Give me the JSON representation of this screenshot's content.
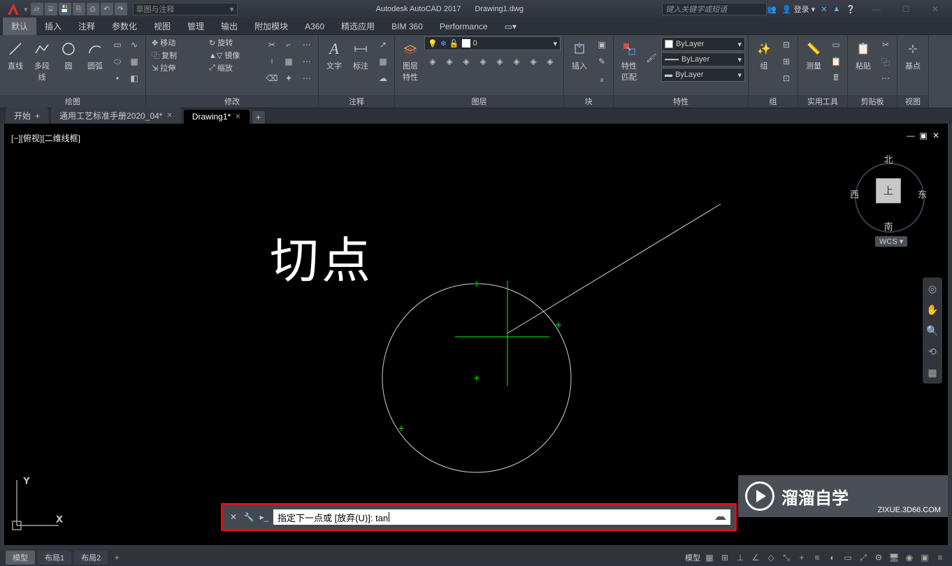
{
  "app": {
    "name": "Autodesk AutoCAD 2017",
    "file": "Drawing1.dwg",
    "search_placeholder": "键入关键字或短语",
    "login": "登录",
    "qat_placeholder": "草图与注释"
  },
  "menu": {
    "tabs": [
      "默认",
      "插入",
      "注释",
      "参数化",
      "视图",
      "管理",
      "输出",
      "附加模块",
      "A360",
      "精选应用",
      "BIM 360",
      "Performance"
    ]
  },
  "ribbon": {
    "draw": {
      "label": "绘图",
      "line": "直线",
      "polyline": "多段线",
      "circle": "圆",
      "arc": "圆弧"
    },
    "modify": {
      "label": "修改",
      "move": "移动",
      "rotate": "旋转",
      "copy": "复制",
      "mirror": "镜像",
      "stretch": "拉伸",
      "scale": "缩放"
    },
    "annotate": {
      "label": "注释",
      "text": "文字",
      "dim": "标注"
    },
    "layers": {
      "label": "图层",
      "props": "图层\n特性",
      "current": "0"
    },
    "block": {
      "label": "块",
      "insert": "插入"
    },
    "properties": {
      "label": "特性",
      "match": "特性\n匹配",
      "color": "ByLayer",
      "ltype": "ByLayer",
      "lweight": "ByLayer"
    },
    "groups": {
      "label": "组",
      "group": "组"
    },
    "utilities": {
      "label": "实用工具",
      "measure": "测量"
    },
    "clipboard": {
      "label": "剪贴板",
      "paste": "粘贴"
    },
    "view": {
      "label": "视图",
      "base": "基点"
    }
  },
  "file_tabs": {
    "start": "开始",
    "doc1": "通用工艺标准手册2020_04*",
    "doc2": "Drawing1*"
  },
  "canvas": {
    "viewlabel": "[−][俯视][二维线框]",
    "title": "切点",
    "n": "北",
    "s": "南",
    "e": "东",
    "w": "西",
    "top": "上",
    "wcs": "WCS"
  },
  "cmdline": {
    "prompt": "指定下一点或 [放弃(U)]: tan"
  },
  "status": {
    "model": "模型",
    "layout1": "布局1",
    "layout2": "布局2",
    "model_r": "模型"
  },
  "watermark": {
    "text": "溜溜自学",
    "url": "ZIXUE.3D66.COM"
  },
  "ucs": {
    "x": "X",
    "y": "Y"
  }
}
